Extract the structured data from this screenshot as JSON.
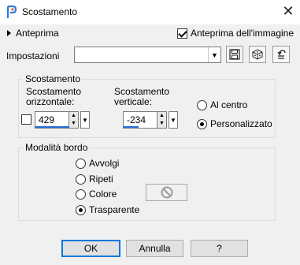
{
  "window": {
    "title": "Scostamento",
    "close_glyph": "✕"
  },
  "preview": {
    "toggle_label": "Anteprima",
    "checkbox_label": "Anteprima dell'immagine",
    "checkbox_checked": true
  },
  "settings": {
    "label": "Impostazioni",
    "value": ""
  },
  "offset_group": {
    "title": "Scostamento",
    "horizontal_label_line1": "Scostamento",
    "horizontal_label_line2": "orizzontale:",
    "vertical_label_line1": "Scostamento",
    "vertical_label_line2": "verticale:",
    "horizontal_value": "429",
    "vertical_value": "-234",
    "radio_center": "Al centro",
    "radio_custom": "Personalizzato",
    "selected": "Personalizzato"
  },
  "border_group": {
    "title": "Modalità bordo",
    "options": [
      "Avvolgi",
      "Ripeti",
      "Colore",
      "Trasparente"
    ],
    "selected": "Trasparente"
  },
  "buttons": {
    "ok": "OK",
    "cancel": "Annulla",
    "help": "?"
  },
  "icons": {
    "app": "app-icon",
    "save": "save-icon",
    "random": "dice-icon",
    "reset": "reset-icon",
    "no_color": "no-symbol-icon"
  },
  "colors": {
    "accent": "#0078d7",
    "spin_underline": "#2a6fd6"
  }
}
